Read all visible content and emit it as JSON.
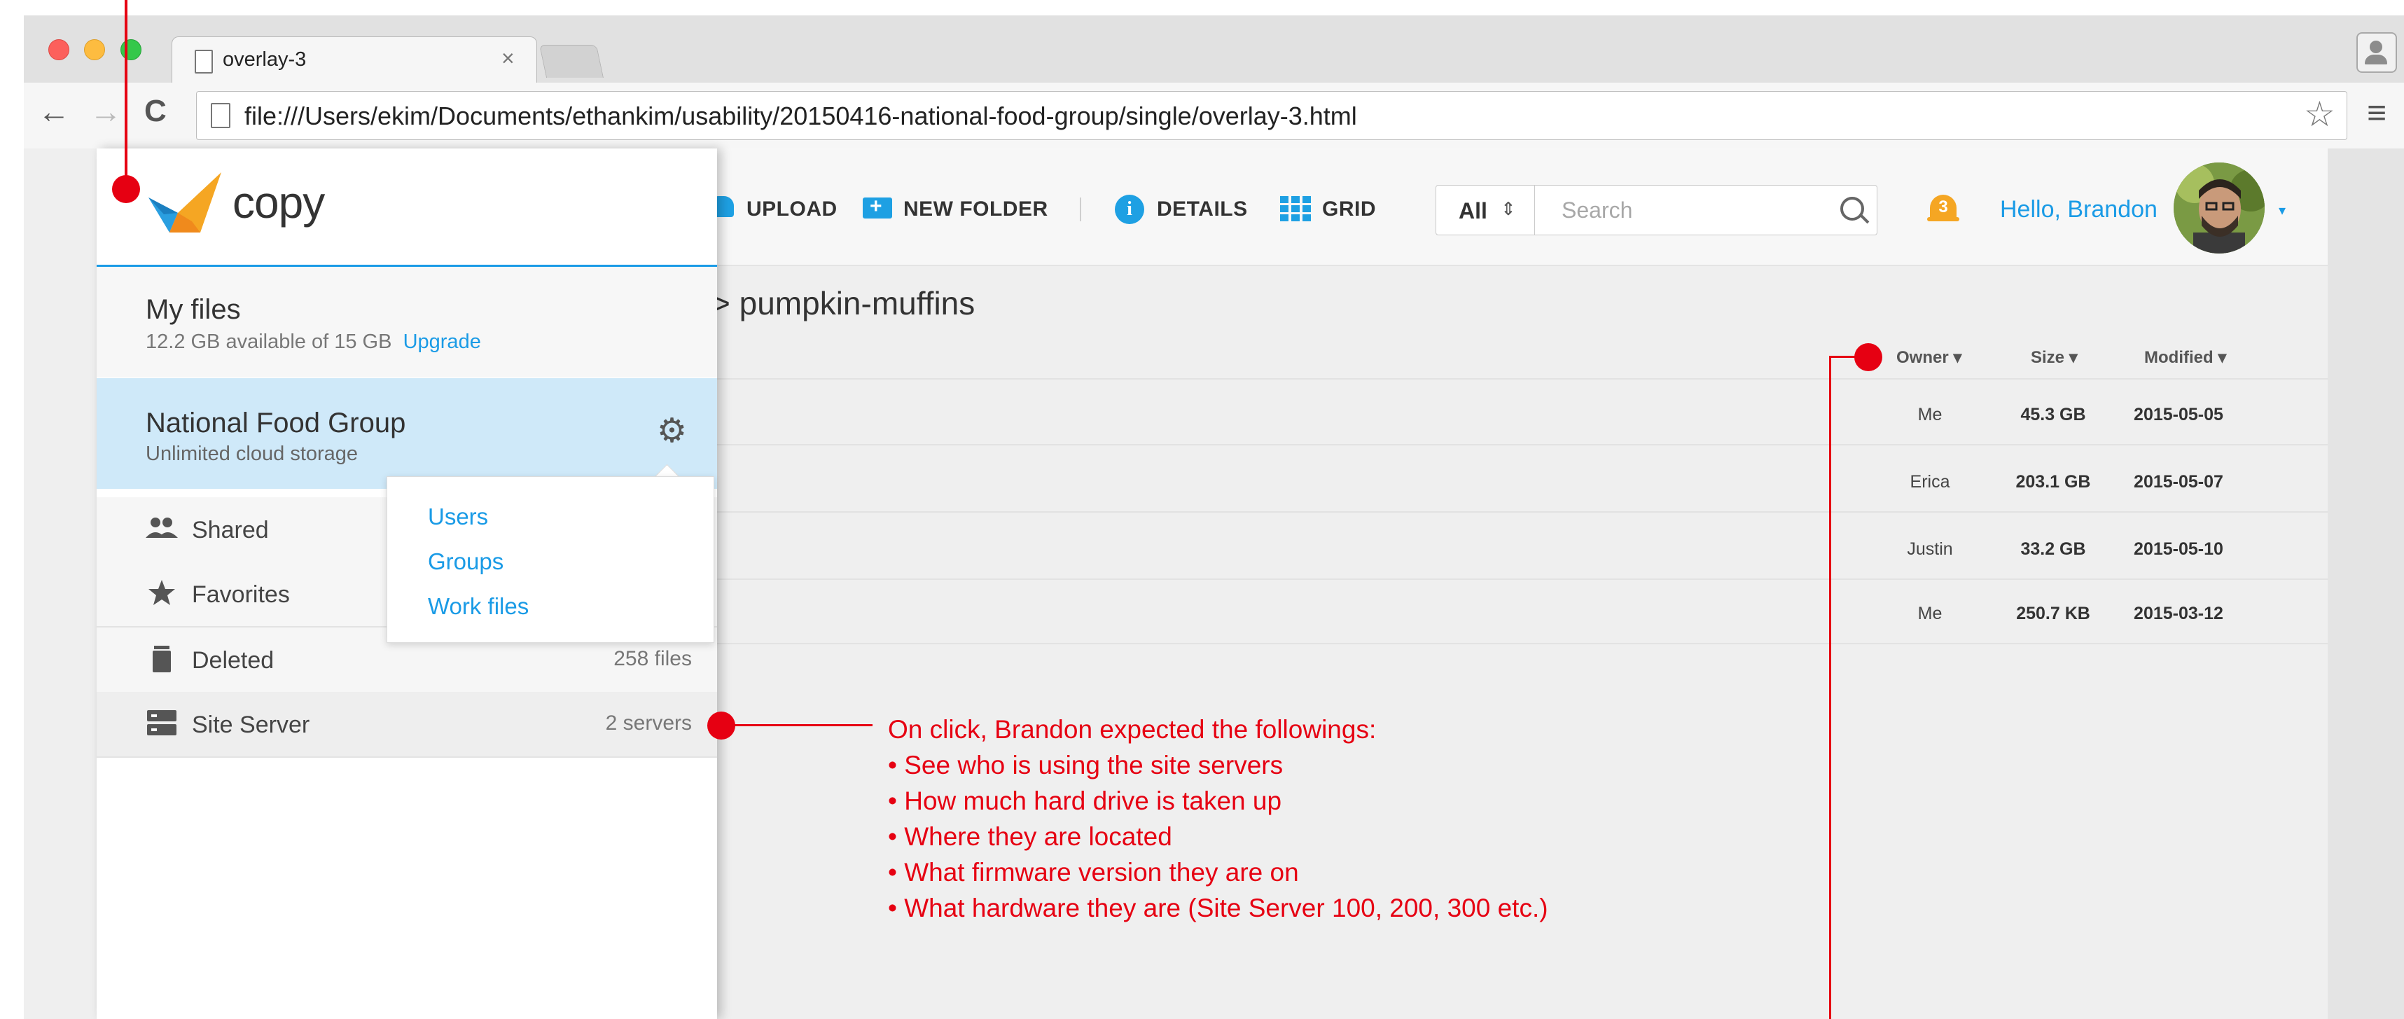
{
  "browser": {
    "tab_title": "overlay-3",
    "tab_close": "×",
    "url": "file:///Users/ekim/Documents/ethankim/usability/20150416-national-food-group/single/overlay-3.html",
    "back_glyph": "←",
    "forward_glyph": "→",
    "reload_glyph": "C",
    "star_glyph": "☆",
    "menu_glyph": "≡"
  },
  "app": {
    "logo_text": "copy",
    "toolbar": {
      "upload_label": "UPLOAD",
      "new_folder_label": "NEW FOLDER",
      "details_label": "DETAILS",
      "details_glyph": "i",
      "grid_label": "GRID"
    },
    "filter": {
      "value": "All",
      "arrows": "⇕"
    },
    "search": {
      "placeholder": "Search",
      "value": ""
    },
    "notifications": {
      "count": "3"
    },
    "greeting": "Hello, Brandon",
    "avatar_caret": "▾",
    "brand_color": "#1a9be6",
    "alert_color": "#f5a623"
  },
  "sidebar": {
    "my_files": {
      "title": "My files",
      "storage": "12.2 GB available of 15 GB",
      "upgrade": "Upgrade"
    },
    "group": {
      "title": "National Food Group",
      "subtitle": "Unlimited cloud storage",
      "gear_glyph": "⚙"
    },
    "items": [
      {
        "label": "Shared",
        "count": "",
        "icon": "people-icon"
      },
      {
        "label": "Favorites",
        "count": "",
        "icon": "star-icon"
      },
      {
        "label": "Deleted",
        "count": "258 files",
        "icon": "trash-icon"
      },
      {
        "label": "Site Server",
        "count": "2 servers",
        "icon": "server-icon"
      }
    ],
    "popover": [
      "Users",
      "Groups",
      "Work files"
    ]
  },
  "listing": {
    "breadcrumb": "> pumpkin-muffins",
    "columns": {
      "owner": "Owner ▾",
      "size": "Size ▾",
      "modified": "Modified ▾"
    },
    "rows": [
      {
        "owner": "Me",
        "size": "45.3 GB",
        "modified": "2015-05-05"
      },
      {
        "owner": "Erica",
        "size": "203.1 GB",
        "modified": "2015-05-07"
      },
      {
        "owner": "Justin",
        "size": "33.2 GB",
        "modified": "2015-05-10"
      },
      {
        "owner": "Me",
        "size": "250.7 KB",
        "modified": "2015-03-12"
      }
    ]
  },
  "annotation": {
    "color": "#e60012",
    "heading": "On click, Brandon expected the followings:",
    "bullets": [
      "• See who is using the site servers",
      "• How much hard drive is taken up",
      "• Where they are located",
      "• What firmware version they are on",
      "• What hardware they are (Site Server 100, 200, 300 etc.)"
    ]
  }
}
